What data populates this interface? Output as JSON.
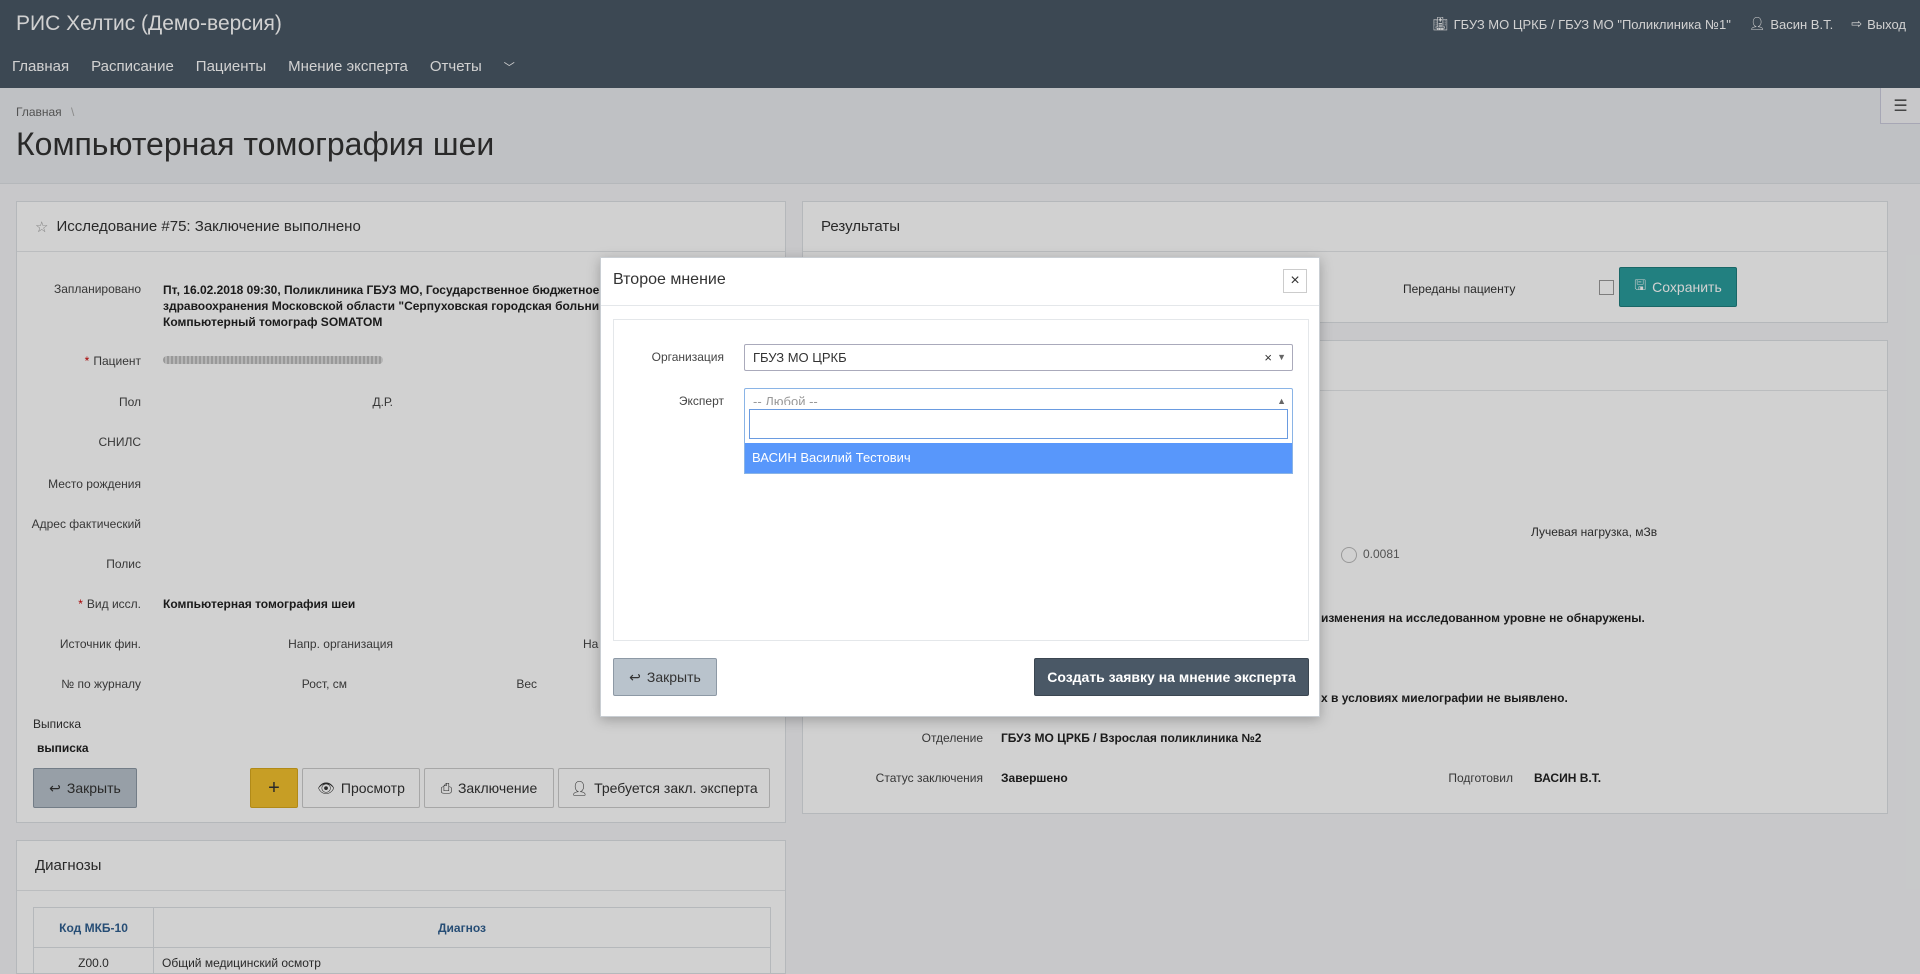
{
  "header": {
    "app_title": "РИС Хелтис (Демо-версия)",
    "org": "ГБУЗ МО ЦРКБ / ГБУЗ МО \"Поликлиника №1\"",
    "user": "Васин В.Т.",
    "logout": "Выход"
  },
  "nav": {
    "items": [
      "Главная",
      "Расписание",
      "Пациенты",
      "Мнение эксперта",
      "Отчеты"
    ]
  },
  "breadcrumb": {
    "home": "Главная",
    "sep": "\\"
  },
  "page_title": "Компьютерная томография шеи",
  "study": {
    "title": "Исследование #75: Заключение выполнено",
    "labels": {
      "planned": "Запланировано",
      "patient": "Пациент",
      "sex": "Пол",
      "dob": "Д.Р.",
      "snils": "СНИЛС",
      "birthplace": "Место рождения",
      "address": "Адрес фактический",
      "policy": "Полис",
      "study_type": "Вид иссл.",
      "fin_source": "Источник фин.",
      "ref_org": "Напр. организация",
      "ref_short": "На",
      "journal": "№ по журналу",
      "height": "Рост, см",
      "weight": "Вес",
      "extract": "Выписка"
    },
    "planned_value": "Пт, 16.02.2018 09:30, Поликлиника ГБУЗ МО, Государственное бюджетное здравоохранения Московской области \"Серпуховская городская больни Компьютерный томограф SOMATOM",
    "planned_line1": "Пт, 16.02.2018 09:30, Поликлиника ГБУЗ МО, Государственное бюджетное",
    "planned_line2": "здравоохранения Московской области \"Серпуховская городская больни",
    "planned_line3": "Компьютерный томограф SOMATOM",
    "study_type_value": "Компьютерная томография шеи",
    "extract_value": "выписка",
    "buttons": {
      "close": "Закрыть",
      "add": "+",
      "view": "Просмотр",
      "conclusion": "Заключение",
      "expert": "Требуется закл. эксперта"
    }
  },
  "results": {
    "title": "Результаты",
    "passed_label": "Переданы пациенту",
    "save": "Сохранить",
    "dose_label": "Лучевая нагрузка, мЗв",
    "dose_value": "0.0081",
    "finding1": "изменения на исследованном уровне не обнаружены.",
    "finding2": "х в условиях миелографии не выявлено.",
    "dept_label": "Отделение",
    "dept_value": "ГБУЗ МО ЦРКБ / Взрослая поликлиника №2",
    "status_label": "Статус заключения",
    "status_value": "Завершено",
    "prepared_label": "Подготовил",
    "prepared_value": "ВАСИН В.Т."
  },
  "diagnoses": {
    "title": "Диагнозы",
    "columns": [
      "Код МКБ-10",
      "Диагноз"
    ],
    "rows": [
      {
        "code": "Z00.0",
        "name": "Общий медицинский осмотр"
      }
    ]
  },
  "modal": {
    "title": "Второе мнение",
    "org_label": "Организация",
    "org_value": "ГБУЗ МО ЦРКБ",
    "expert_label": "Эксперт",
    "expert_placeholder": "-- Любой --",
    "options": [
      "ВАСИН Василий Тестович"
    ],
    "close": "Закрыть",
    "create": "Создать заявку на мнение эксперта"
  },
  "colors": {
    "header_bg": "#4a5866",
    "teal": "#2a9d9d",
    "yellow": "#f3c12e",
    "highlight": "#5897fb"
  }
}
